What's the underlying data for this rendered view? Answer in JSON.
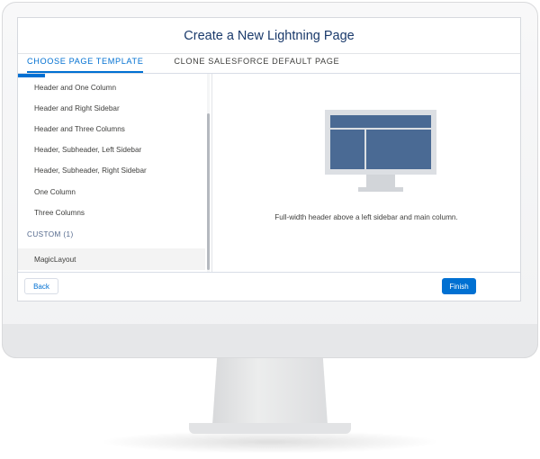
{
  "modal": {
    "title": "Create a New Lightning Page"
  },
  "tabs": [
    {
      "label": "Choose Page Template"
    },
    {
      "label": "Clone Salesforce Default Page"
    }
  ],
  "template_list": {
    "standard_items": [
      "Header and One Column",
      "Header and Right Sidebar",
      "Header and Three Columns",
      "Header, Subheader, Left Sidebar",
      "Header, Subheader, Right Sidebar",
      "One Column",
      "Three Columns"
    ],
    "custom_section_label": "CUSTOM (1)",
    "custom_items": [
      "MagicLayout"
    ]
  },
  "preview": {
    "caption": "Full-width header above a left sidebar and main column.",
    "icon": "layout-preview-icon",
    "colors": {
      "block": "#4a6a94",
      "frame": "#dcdfe3"
    }
  },
  "footer": {
    "back_label": "Back",
    "finish_label": "Finish"
  },
  "colors": {
    "accent": "#0070d2",
    "title": "#1a3a6b"
  }
}
